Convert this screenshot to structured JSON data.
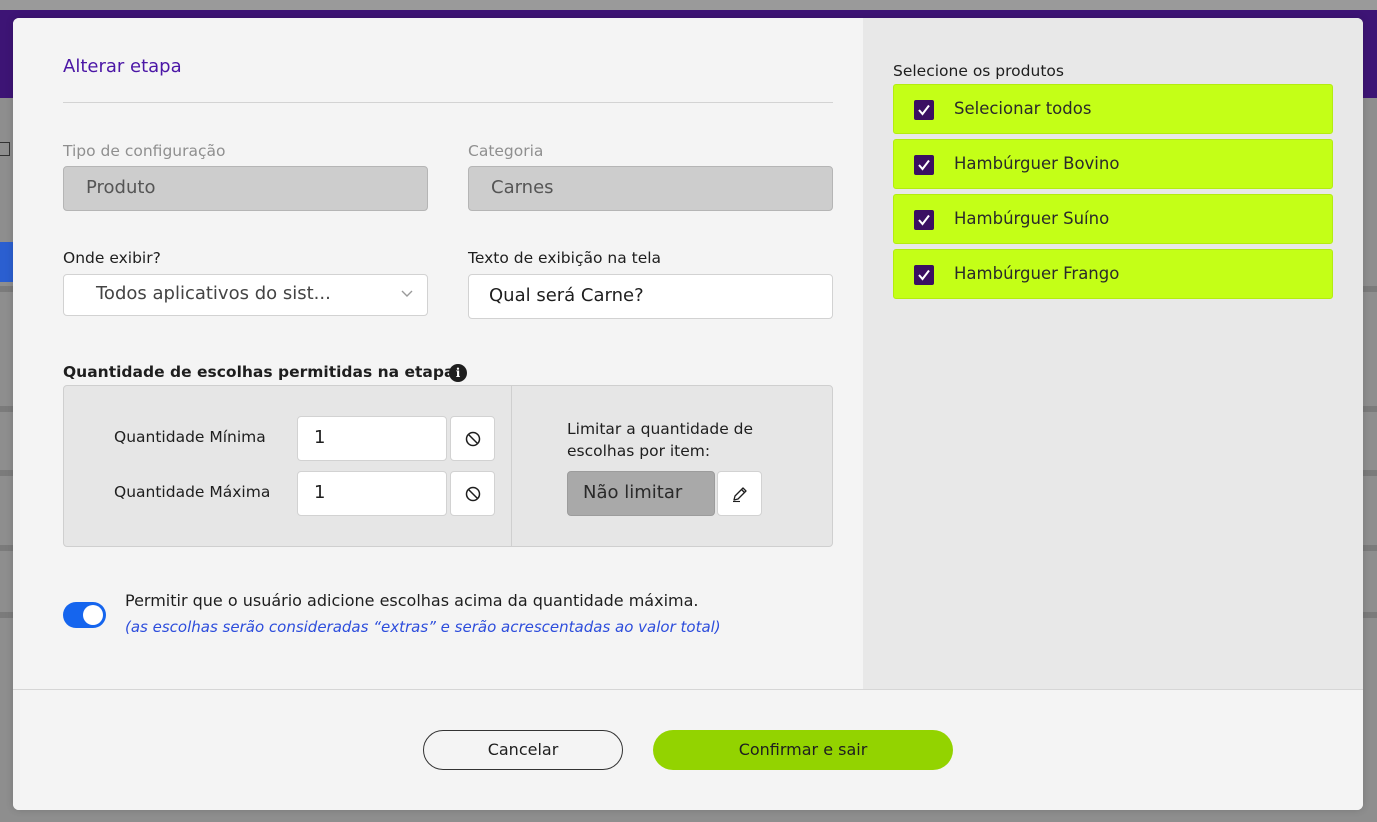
{
  "dialog": {
    "title": "Alterar etapa",
    "config_type_label": "Tipo de configuração",
    "config_type_value": "Produto",
    "category_label": "Categoria",
    "category_value": "Carnes",
    "display_where_label": "Onde exibir?",
    "display_where_value": "Todos aplicativos do sist...",
    "display_text_label": "Texto de exibição na tela",
    "display_text_value": "Qual será Carne?",
    "quantity_section_label": "Quantidade de escolhas permitidas na etapa:",
    "info_icon_glyph": "i",
    "min_label": "Quantidade Mínima",
    "min_value": "1",
    "max_label": "Quantidade Máxima",
    "max_value": "1",
    "limit_label": "Limitar a quantidade de escolhas por item:",
    "limit_value": "Não limitar",
    "allow_extra_label": "Permitir que o usuário adicione escolhas acima da quantidade máxima.",
    "allow_extra_note": "(as escolhas serão consideradas “extras” e serão acrescentadas ao valor total)",
    "allow_extra_enabled": true
  },
  "products": {
    "title": "Selecione os produtos",
    "items": [
      {
        "label": "Selecionar todos",
        "checked": true
      },
      {
        "label": "Hambúrguer Bovino",
        "checked": true
      },
      {
        "label": "Hambúrguer Suíno",
        "checked": true
      },
      {
        "label": "Hambúrguer Frango",
        "checked": true
      }
    ]
  },
  "footer": {
    "cancel_label": "Cancelar",
    "confirm_label": "Confirmar e sair"
  },
  "colors": {
    "accent_purple": "#4b16a6",
    "toggle_blue": "#1565ee",
    "product_highlight": "#c4ff17",
    "confirm_green": "#93d300",
    "checkbox_purple": "#3a0f62"
  },
  "icons": {
    "chevron": "chevron-down-icon",
    "clear": "block-icon",
    "edit": "pencil-icon",
    "checkbox": "checkmark-icon",
    "info": "info-icon"
  }
}
